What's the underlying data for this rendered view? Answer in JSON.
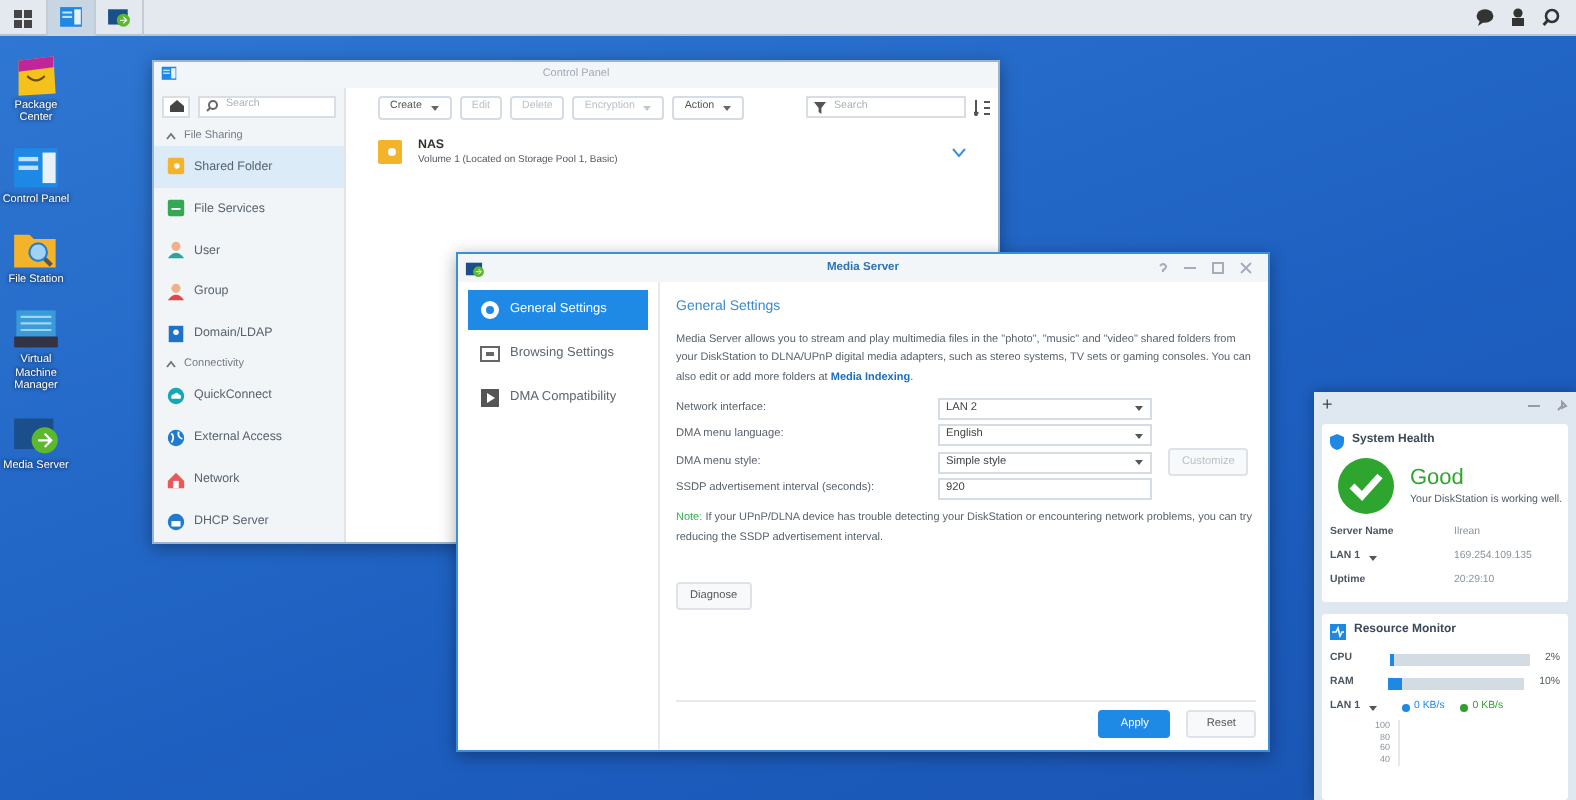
{
  "taskbar": {
    "apps": [
      {
        "kind": "control-panel",
        "selected": true
      },
      {
        "kind": "media-server",
        "selected": false
      }
    ]
  },
  "desktop_icons": [
    {
      "label": "Package Center",
      "kind": "package"
    },
    {
      "label": "Control Panel",
      "kind": "control-panel"
    },
    {
      "label": "File Station",
      "kind": "file-station"
    },
    {
      "label": "Virtual Machine Manager",
      "kind": "vm"
    },
    {
      "label": "Media Server",
      "kind": "media-server"
    }
  ],
  "control_panel": {
    "title": "Control Panel",
    "search_placeholder": "Search",
    "sections": [
      {
        "title": "File Sharing",
        "expanded": true,
        "items": [
          {
            "label": "Shared Folder",
            "kind": "folder",
            "selected": true
          },
          {
            "label": "File Services",
            "kind": "services",
            "selected": false
          },
          {
            "label": "User",
            "kind": "user",
            "selected": false
          },
          {
            "label": "Group",
            "kind": "group",
            "selected": false
          },
          {
            "label": "Domain/LDAP",
            "kind": "domain",
            "selected": false
          }
        ]
      },
      {
        "title": "Connectivity",
        "expanded": true,
        "items": [
          {
            "label": "QuickConnect",
            "kind": "cloud",
            "selected": false
          },
          {
            "label": "External Access",
            "kind": "globe",
            "selected": false
          },
          {
            "label": "Network",
            "kind": "house",
            "selected": false
          },
          {
            "label": "DHCP Server",
            "kind": "dhcp",
            "selected": false
          }
        ]
      }
    ],
    "toolbar": [
      {
        "label": "Create",
        "dropdown": true,
        "disabled": false
      },
      {
        "label": "Edit",
        "dropdown": false,
        "disabled": true
      },
      {
        "label": "Delete",
        "dropdown": false,
        "disabled": true
      },
      {
        "label": "Encryption",
        "dropdown": true,
        "disabled": true
      },
      {
        "label": "Action",
        "dropdown": true,
        "disabled": false
      }
    ],
    "filter_placeholder": "Search",
    "folders": [
      {
        "name": "NAS",
        "detail": "Volume 1 (Located on Storage Pool 1, Basic)"
      }
    ]
  },
  "media_server": {
    "title": "Media Server",
    "nav": [
      {
        "label": "General Settings",
        "kind": "gear",
        "selected": true
      },
      {
        "label": "Browsing Settings",
        "kind": "monitor",
        "selected": false
      },
      {
        "label": "DMA Compatibility",
        "kind": "play",
        "selected": false
      }
    ],
    "heading": "General Settings",
    "description": "Media Server allows you to stream and play multimedia files in the \"photo\", \"music\" and \"video\" shared folders from your DiskStation to DLNA/UPnP digital media adapters, such as stereo systems, TV sets or gaming consoles. You can also edit or add more folders at",
    "link": "Media Indexing",
    "description_end": ".",
    "fields": [
      {
        "label": "Network interface:",
        "value": "LAN 2",
        "kind": "select"
      },
      {
        "label": "DMA menu language:",
        "value": "English",
        "kind": "select"
      },
      {
        "label": "DMA menu style:",
        "value": "Simple style",
        "kind": "select",
        "button": "Customize",
        "button_disabled": true
      },
      {
        "label": "SSDP advertisement interval (seconds):",
        "value": "920",
        "kind": "input"
      }
    ],
    "note_label": "Note:",
    "note": "If your UPnP/DLNA device has trouble detecting your DiskStation or encountering network problems, you can try reducing the SSDP advertisement interval.",
    "diagnose": "Diagnose",
    "apply": "Apply",
    "reset": "Reset"
  },
  "widgets": {
    "add": "+",
    "system_health": {
      "title": "System Health",
      "status": "Good",
      "message": "Your DiskStation is working well.",
      "rows": [
        {
          "label": "Server Name",
          "value": "Ilrean",
          "dropdown": false
        },
        {
          "label": "LAN 1",
          "value": "169.254.109.135",
          "dropdown": true
        },
        {
          "label": "Uptime",
          "value": "20:29:10",
          "dropdown": false
        }
      ]
    },
    "resource_monitor": {
      "title": "Resource Monitor",
      "meters": [
        {
          "label": "CPU",
          "level": 0.02,
          "reading": "2%"
        },
        {
          "label": "RAM",
          "level": 0.1,
          "reading": "10%"
        }
      ],
      "network": {
        "label": "LAN 1",
        "rates": [
          {
            "value": "0 KB/s",
            "color": "#1e88e5"
          },
          {
            "value": "0 KB/s",
            "color": "#2e9e2e"
          }
        ]
      },
      "axis_labels": [
        "100",
        "80",
        "60",
        "40"
      ]
    }
  }
}
